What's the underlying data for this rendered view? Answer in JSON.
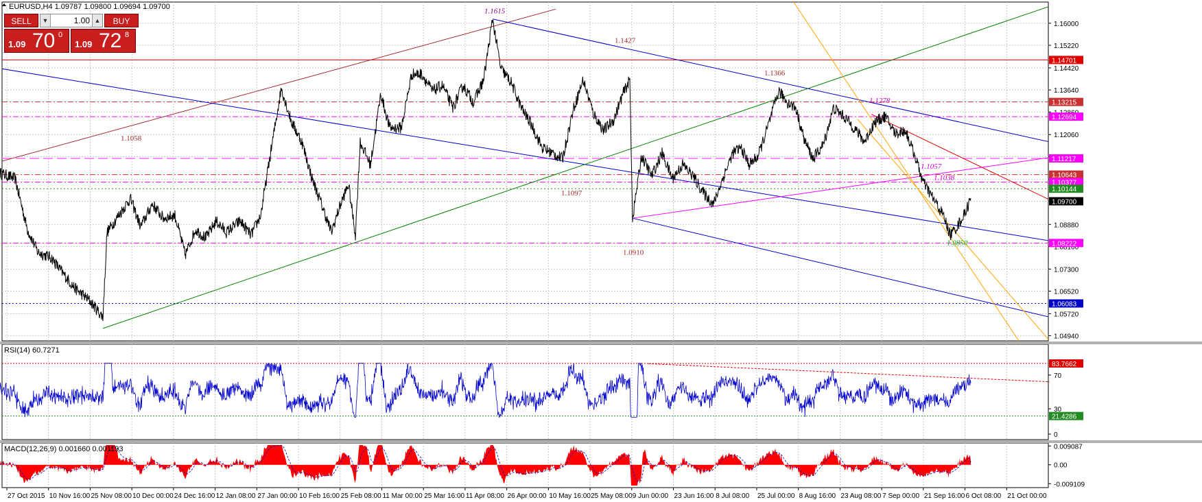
{
  "window": {
    "symbol_title": "EURUSD,H4  1.09787 1.09800 1.09694 1.09700"
  },
  "trade_panel": {
    "sell_label": "SELL",
    "buy_label": "BUY",
    "lot": "1.00",
    "sell_price_small": "1.09",
    "sell_price_big": "70",
    "sell_price_frac": "0",
    "buy_price_small": "1.09",
    "buy_price_big": "72",
    "buy_price_frac": "8"
  },
  "chart_data": [
    {
      "type": "line",
      "title": "EURUSD,H4",
      "ohlc_last": {
        "open": 1.09787,
        "high": 1.098,
        "low": 1.09694,
        "close": 1.097
      },
      "x_tick_labels": [
        "27 Oct 2015",
        "10 Nov 16:00",
        "25 Nov 08:00",
        "10 Dec 00:00",
        "24 Dec 16:00",
        "12 Jan 08:00",
        "27 Jan 00:00",
        "10 Feb 16:00",
        "25 Feb 08:00",
        "11 Mar 00:00",
        "25 Mar 16:00",
        "11 Apr 08:00",
        "26 Apr 00:00",
        "10 May 16:00",
        "25 May 08:00",
        "9 Jun 00:00",
        "23 Jun 16:00",
        "8 Jul 08:00",
        "25 Jul 00:00",
        "8 Aug 16:00",
        "23 Aug 08:00",
        "7 Sep 00:00",
        "21 Sep 16:00",
        "6 Oct 08:00",
        "21 Oct 00:00"
      ],
      "y_tick_labels": [
        "1.16000",
        "1.15220",
        "1.14420",
        "1.13640",
        "1.12860",
        "1.12060",
        "1.11280",
        "1.10480",
        "1.09700",
        "1.08880",
        "1.08100",
        "1.07300",
        "1.06520",
        "1.05720",
        "1.04940"
      ],
      "ylim": [
        1.0476,
        1.1675
      ],
      "grid": true,
      "price_key_points": [
        [
          0,
          1.107
        ],
        [
          22,
          1.105
        ],
        [
          40,
          1.087
        ],
        [
          55,
          1.079
        ],
        [
          75,
          1.077
        ],
        [
          90,
          1.072
        ],
        [
          110,
          1.066
        ],
        [
          130,
          1.062
        ],
        [
          150,
          1.056
        ],
        [
          156,
          1.086
        ],
        [
          170,
          1.091
        ],
        [
          190,
          1.098
        ],
        [
          205,
          1.088
        ],
        [
          222,
          1.096
        ],
        [
          238,
          1.091
        ],
        [
          255,
          1.092
        ],
        [
          270,
          1.078
        ],
        [
          285,
          1.087
        ],
        [
          300,
          1.084
        ],
        [
          315,
          1.09
        ],
        [
          330,
          1.086
        ],
        [
          350,
          1.09
        ],
        [
          366,
          1.085
        ],
        [
          380,
          1.092
        ],
        [
          395,
          1.115
        ],
        [
          410,
          1.137
        ],
        [
          425,
          1.125
        ],
        [
          440,
          1.118
        ],
        [
          455,
          1.105
        ],
        [
          470,
          1.095
        ],
        [
          483,
          1.086
        ],
        [
          495,
          1.095
        ],
        [
          508,
          1.103
        ],
        [
          518,
          1.085
        ],
        [
          525,
          1.118
        ],
        [
          540,
          1.11
        ],
        [
          555,
          1.135
        ],
        [
          568,
          1.123
        ],
        [
          585,
          1.123
        ],
        [
          600,
          1.142
        ],
        [
          615,
          1.142
        ],
        [
          630,
          1.136
        ],
        [
          645,
          1.138
        ],
        [
          660,
          1.13
        ],
        [
          675,
          1.138
        ],
        [
          690,
          1.132
        ],
        [
          705,
          1.14
        ],
        [
          718,
          1.1615
        ],
        [
          730,
          1.144
        ],
        [
          745,
          1.139
        ],
        [
          760,
          1.13
        ],
        [
          775,
          1.124
        ],
        [
          790,
          1.116
        ],
        [
          805,
          1.114
        ],
        [
          820,
          1.112
        ],
        [
          835,
          1.129
        ],
        [
          850,
          1.14
        ],
        [
          865,
          1.128
        ],
        [
          880,
          1.122
        ],
        [
          895,
          1.126
        ],
        [
          908,
          1.135
        ],
        [
          918,
          1.14
        ],
        [
          922,
          1.091
        ],
        [
          935,
          1.113
        ],
        [
          950,
          1.106
        ],
        [
          965,
          1.114
        ],
        [
          980,
          1.105
        ],
        [
          995,
          1.11
        ],
        [
          1010,
          1.106
        ],
        [
          1025,
          1.1
        ],
        [
          1040,
          1.096
        ],
        [
          1055,
          1.106
        ],
        [
          1068,
          1.114
        ],
        [
          1080,
          1.116
        ],
        [
          1092,
          1.11
        ],
        [
          1105,
          1.113
        ],
        [
          1120,
          1.124
        ],
        [
          1135,
          1.136
        ],
        [
          1148,
          1.132
        ],
        [
          1160,
          1.13
        ],
        [
          1172,
          1.119
        ],
        [
          1185,
          1.112
        ],
        [
          1200,
          1.117
        ],
        [
          1215,
          1.13
        ],
        [
          1230,
          1.127
        ],
        [
          1245,
          1.123
        ],
        [
          1260,
          1.118
        ],
        [
          1275,
          1.125
        ],
        [
          1290,
          1.127
        ],
        [
          1305,
          1.121
        ],
        [
          1320,
          1.122
        ],
        [
          1335,
          1.112
        ],
        [
          1345,
          1.104
        ],
        [
          1360,
          1.098
        ],
        [
          1375,
          1.092
        ],
        [
          1385,
          1.085
        ],
        [
          1395,
          1.088
        ],
        [
          1405,
          1.092
        ],
        [
          1415,
          1.098
        ]
      ],
      "horizontal_levels": [
        {
          "value": 1.14701,
          "label": "1.14701",
          "color": "#e00000",
          "style": "solid",
          "tag_bg": "#e00000"
        },
        {
          "value": 1.13215,
          "label": "1.13215",
          "color": "#c83232",
          "style": "dashdot",
          "tag_bg": "#c83232"
        },
        {
          "value": 1.12694,
          "label": "1.12694",
          "color": "#ff00ff",
          "style": "dashdot",
          "tag_bg": "#ff00ff"
        },
        {
          "value": 1.11217,
          "label": "1.11217",
          "color": "#ff66ff",
          "style": "longdash",
          "tag_bg": "#ff00ff"
        },
        {
          "value": 1.10643,
          "label": "1.10643",
          "color": "#c83232",
          "style": "dashdot",
          "tag_bg": "#c83232"
        },
        {
          "value": 1.10377,
          "label": "1.10377",
          "color": "#ff00ff",
          "style": "dashdot",
          "tag_bg": "#ff00ff"
        },
        {
          "value": 1.10144,
          "label": "1.10144",
          "color": "#228b22",
          "style": "dotted",
          "tag_bg": "#228b22"
        },
        {
          "value": 1.097,
          "label": "1.09700",
          "color": "#000000",
          "style": "none",
          "tag_bg": "#000000"
        },
        {
          "value": 1.08222,
          "label": "1.08222",
          "color": "#ff00ff",
          "style": "dashdot",
          "tag_bg": "#ff00ff"
        },
        {
          "value": 1.06083,
          "label": "1.06083",
          "color": "#0000c8",
          "style": "dotted",
          "tag_bg": "#0000c8"
        }
      ],
      "trend_lines": [
        {
          "from": [
            0,
            1.111
          ],
          "to": [
            810,
            1.165
          ],
          "color": "#a52a2a"
        },
        {
          "from": [
            0,
            1.144
          ],
          "to": [
            1530,
            1.083
          ],
          "color": "#0000cd"
        },
        {
          "from": [
            718,
            1.1615
          ],
          "to": [
            1530,
            1.118
          ],
          "color": "#0000cd"
        },
        {
          "from": [
            922,
            1.091
          ],
          "to": [
            1530,
            1.056
          ],
          "color": "#0000cd"
        },
        {
          "from": [
            150,
            1.052
          ],
          "to": [
            1530,
            1.166
          ],
          "color": "#008000"
        },
        {
          "from": [
            922,
            1.091
          ],
          "to": [
            1530,
            1.1125
          ],
          "color": "#ff00ff"
        },
        {
          "from": [
            1270,
            1.1278
          ],
          "to": [
            1530,
            1.0975
          ],
          "color": "#e00000"
        },
        {
          "from": [
            1150,
            1.17
          ],
          "to": [
            1485,
            1.0476
          ],
          "color": "#ffa500"
        },
        {
          "from": [
            1250,
            1.126
          ],
          "to": [
            1530,
            1.0476
          ],
          "color": "#ffa500"
        }
      ],
      "annotations": [
        {
          "text": "1.1615",
          "at": [
            706,
            1.1635
          ],
          "color": "#800080",
          "italic": true
        },
        {
          "text": "1.1427",
          "at": [
            896,
            1.153
          ],
          "color": "#a52a2a",
          "italic": false
        },
        {
          "text": "1.1366",
          "at": [
            1114,
            1.1415
          ],
          "color": "#a52a2a",
          "italic": false
        },
        {
          "text": "1.1278",
          "at": [
            1267,
            1.1318
          ],
          "color": "#cc00cc",
          "italic": true
        },
        {
          "text": "1.1058",
          "at": [
            176,
            1.1185
          ],
          "color": "#a52a2a",
          "italic": false
        },
        {
          "text": "1.1057",
          "at": [
            1342,
            1.1085
          ],
          "color": "#cc00cc",
          "italic": true
        },
        {
          "text": "1.1038",
          "at": [
            1361,
            1.1045
          ],
          "color": "#cc00cc",
          "italic": true
        },
        {
          "text": "1.1097",
          "at": [
            818,
            1.099
          ],
          "color": "#a52a2a",
          "italic": false
        },
        {
          "text": "1.0910",
          "at": [
            908,
            1.078
          ],
          "color": "#a52a2a",
          "italic": false
        },
        {
          "text": "1.0850",
          "at": [
            1380,
            1.0815
          ],
          "color": "#00aa00",
          "italic": true
        }
      ]
    },
    {
      "type": "line",
      "title": "RSI(14) 60.7271",
      "ylim": [
        0,
        100
      ],
      "y_tick_labels": [
        "70",
        "30",
        "0"
      ],
      "levels": [
        {
          "value": 83.7662,
          "label": "83.7662",
          "color": "#e00000",
          "tag_bg": "#e00000"
        },
        {
          "value": 21.4286,
          "label": "21.4286",
          "color": "#228b22",
          "tag_bg": "#228b22"
        }
      ],
      "last_value": 60.7271,
      "rsi_trend_line": {
        "from": [
          945,
          83.5
        ],
        "to": [
          1530,
          62
        ],
        "color": "#e00000"
      }
    },
    {
      "type": "area",
      "title": "MACD(12,26,9) 0.001660 0.001193",
      "main": 0.00166,
      "signal": 0.001193,
      "y_tick_labels": [
        "0.009087",
        "0.00",
        "-0.009109"
      ],
      "ylim": [
        -0.011,
        0.0105
      ]
    }
  ]
}
